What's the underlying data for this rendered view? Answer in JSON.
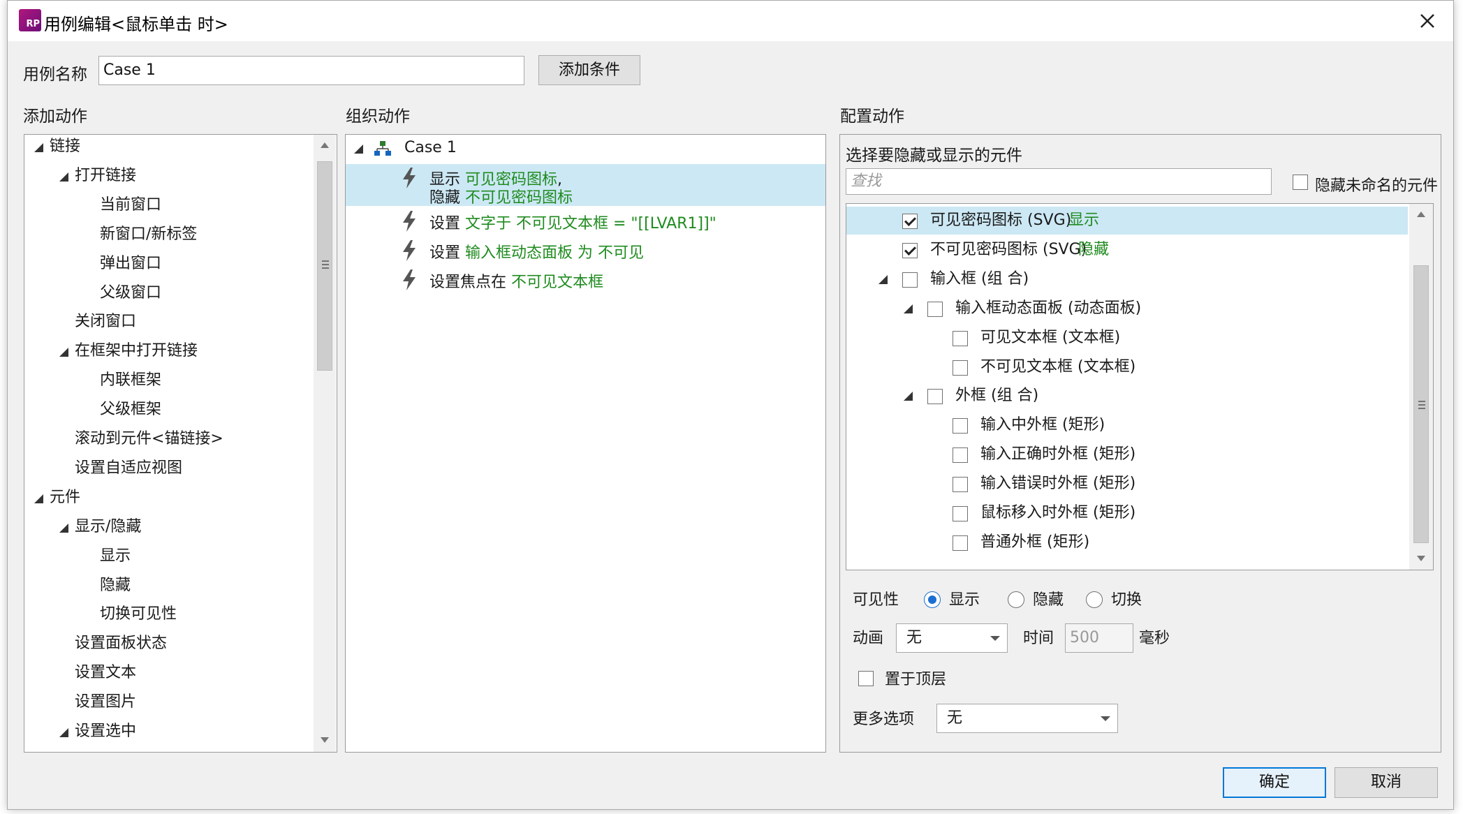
{
  "dialog": {
    "title": "用例编辑<鼠标单击 时>",
    "app_icon_text": "RP"
  },
  "case_name": {
    "label": "用例名称",
    "value": "Case 1",
    "add_condition_label": "添加条件"
  },
  "add_actions": {
    "heading": "添加动作",
    "items": [
      {
        "label": "链接",
        "level": 0,
        "expanded": true
      },
      {
        "label": "打开链接",
        "level": 1,
        "expanded": true
      },
      {
        "label": "当前窗口",
        "level": 2
      },
      {
        "label": "新窗口/新标签",
        "level": 2
      },
      {
        "label": "弹出窗口",
        "level": 2
      },
      {
        "label": "父级窗口",
        "level": 2
      },
      {
        "label": "关闭窗口",
        "level": 1
      },
      {
        "label": "在框架中打开链接",
        "level": 1,
        "expanded": true
      },
      {
        "label": "内联框架",
        "level": 2
      },
      {
        "label": "父级框架",
        "level": 2
      },
      {
        "label": "滚动到元件<锚链接>",
        "level": 1
      },
      {
        "label": "设置自适应视图",
        "level": 1
      },
      {
        "label": "元件",
        "level": 0,
        "expanded": true
      },
      {
        "label": "显示/隐藏",
        "level": 1,
        "expanded": true
      },
      {
        "label": "显示",
        "level": 2
      },
      {
        "label": "隐藏",
        "level": 2
      },
      {
        "label": "切换可见性",
        "level": 2
      },
      {
        "label": "设置面板状态",
        "level": 1
      },
      {
        "label": "设置文本",
        "level": 1
      },
      {
        "label": "设置图片",
        "level": 1
      },
      {
        "label": "设置选中",
        "level": 1,
        "expanded": true
      }
    ]
  },
  "organize_actions": {
    "heading": "组织动作",
    "case_label": "Case 1",
    "actions": [
      {
        "line1_prefix": "显示 ",
        "line1_target": "可见密码图标",
        "line1_suffix": ",",
        "line2_prefix": "隐藏 ",
        "line2_target": "不可见密码图标",
        "selected": true
      },
      {
        "prefix": "设置 ",
        "target": "文字于 不可见文本框 = \"[[LVAR1]]\""
      },
      {
        "prefix": "设置 ",
        "target": "输入框动态面板 为 不可见"
      },
      {
        "prefix": "设置焦点在 ",
        "target": "不可见文本框"
      }
    ]
  },
  "configure": {
    "heading": "配置动作",
    "select_label": "选择要隐藏或显示的元件",
    "search_placeholder": "查找",
    "hide_unnamed_label": "隐藏未命名的元件",
    "widgets": [
      {
        "label": "可见密码图标 (SVG)",
        "status": "显示",
        "checked": true,
        "level": 0,
        "selected": true
      },
      {
        "label": "不可见密码图标 (SVG)",
        "status": "隐藏",
        "checked": true,
        "level": 0
      },
      {
        "label": "输入框 (组 合)",
        "status": "",
        "checked": false,
        "level": 0,
        "expanded": true
      },
      {
        "label": "输入框动态面板 (动态面板)",
        "status": "",
        "checked": false,
        "level": 1,
        "expanded": true
      },
      {
        "label": "可见文本框 (文本框)",
        "status": "",
        "checked": false,
        "level": 2
      },
      {
        "label": "不可见文本框 (文本框)",
        "status": "",
        "checked": false,
        "level": 2
      },
      {
        "label": "外框 (组 合)",
        "status": "",
        "checked": false,
        "level": 1,
        "expanded": true
      },
      {
        "label": "输入中外框 (矩形)",
        "status": "",
        "checked": false,
        "level": 2
      },
      {
        "label": "输入正确时外框 (矩形)",
        "status": "",
        "checked": false,
        "level": 2
      },
      {
        "label": "输入错误时外框 (矩形)",
        "status": "",
        "checked": false,
        "level": 2
      },
      {
        "label": "鼠标移入时外框 (矩形)",
        "status": "",
        "checked": false,
        "level": 2
      },
      {
        "label": "普通外框 (矩形)",
        "status": "",
        "checked": false,
        "level": 2
      }
    ],
    "visibility_label": "可见性",
    "visibility_options": [
      "显示",
      "隐藏",
      "切换"
    ],
    "visibility_selected": "显示",
    "animation_label": "动画",
    "animation_value": "无",
    "time_label": "时间",
    "time_value": "500",
    "time_unit": "毫秒",
    "bring_to_front_label": "置于顶层",
    "more_options_label": "更多选项",
    "more_options_value": "无"
  },
  "footer": {
    "ok_label": "确定",
    "cancel_label": "取消"
  },
  "colors": {
    "accent_green": "#1f8b1f",
    "selection": "#cce8f4",
    "primary_button_border": "#0078d7",
    "app_icon": "#a0157e"
  }
}
